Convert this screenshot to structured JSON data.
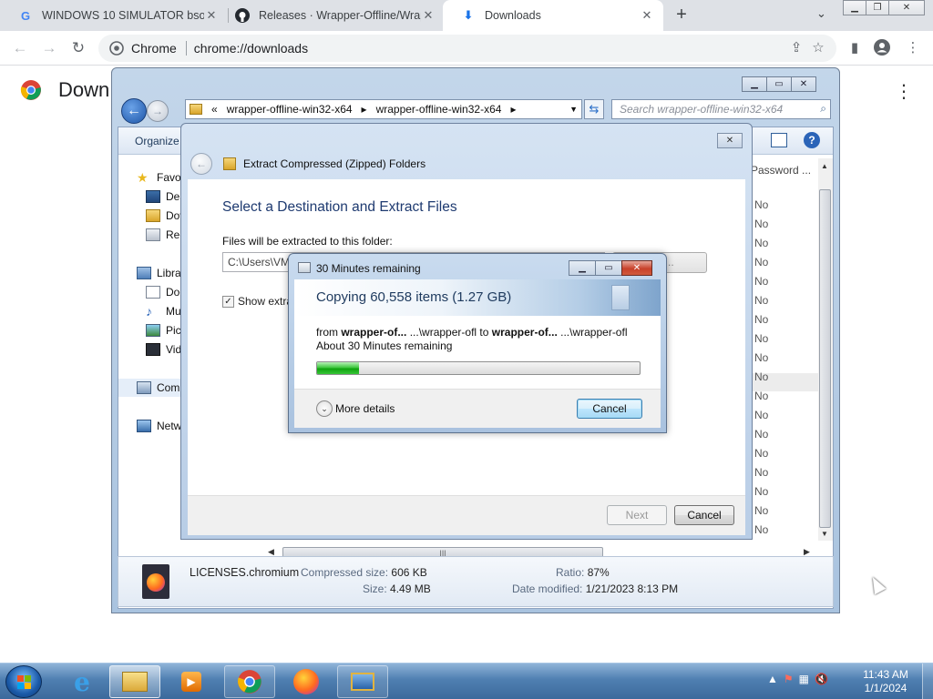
{
  "browser": {
    "tabs": [
      {
        "title": "WINDOWS 10 SIMULATOR bsod",
        "icon": "google-g-icon",
        "active": false
      },
      {
        "title": "Releases · Wrapper-Offline/Wrap",
        "icon": "github-icon",
        "active": false
      },
      {
        "title": "Downloads",
        "icon": "download-icon",
        "active": true
      }
    ],
    "omnibox": {
      "chip": "Chrome",
      "url": "chrome://downloads"
    },
    "page_title": "Down",
    "accent": "#1a73e8"
  },
  "explorer": {
    "address": [
      "«",
      "wrapper-offline-win32-x64",
      "▸",
      "wrapper-offline-win32-x64",
      "▸"
    ],
    "search_placeholder": "Search wrapper-offline-win32-x64",
    "organize": "Organize",
    "nav": {
      "favorites": "Favor",
      "desktop": "Des",
      "downloads": "Dov",
      "recent": "Rec",
      "libraries": "Libra",
      "documents": "Doc",
      "music": "Mu",
      "pictures": "Pic",
      "videos": "Vid",
      "computer": "Com",
      "network": "Netw"
    },
    "column_header": "Password ...",
    "column_values": [
      "No",
      "No",
      "No",
      "No",
      "No",
      "No",
      "No",
      "No",
      "No",
      "No",
      "No",
      "No",
      "No",
      "No",
      "No",
      "No",
      "No",
      "No"
    ],
    "details": {
      "file_name": "LICENSES.chromium",
      "compressed_size_label": "Compressed size:",
      "compressed_size": "606 KB",
      "size_label": "Size:",
      "size": "4.49 MB",
      "ratio_label": "Ratio:",
      "ratio": "87%",
      "date_label": "Date modified:",
      "date": "1/21/2023 8:13 PM"
    }
  },
  "wizard": {
    "title": "Extract Compressed (Zipped) Folders",
    "heading": "Select a Destination and Extract Files",
    "path_label": "Files will be extracted to this folder:",
    "path_value": "C:\\Users\\VM",
    "browse_label": "wse...",
    "checkbox_label": "Show extra",
    "checkbox_checked": true,
    "next_label": "Next",
    "cancel_label": "Cancel"
  },
  "copy_dialog": {
    "title": "30 Minutes remaining",
    "banner": "Copying 60,558 items (1.27 GB)",
    "from_label": "from",
    "from_src": "wrapper-of...",
    "from_src_path": "...\\wrapper-ofl",
    "to_label": "to",
    "to_dst": "wrapper-of...",
    "to_dst_path": "...\\wrapper-ofl",
    "remaining": "About 30 Minutes remaining",
    "progress": 0.13,
    "more_details": "More details",
    "cancel_label": "Cancel"
  },
  "taskbar": {
    "time": "11:43 AM",
    "date": "1/1/2024",
    "items": [
      "ie-icon",
      "explorer-icon",
      "media-player-icon",
      "chrome-icon",
      "firefox-icon",
      "remote-desktop-icon"
    ]
  }
}
